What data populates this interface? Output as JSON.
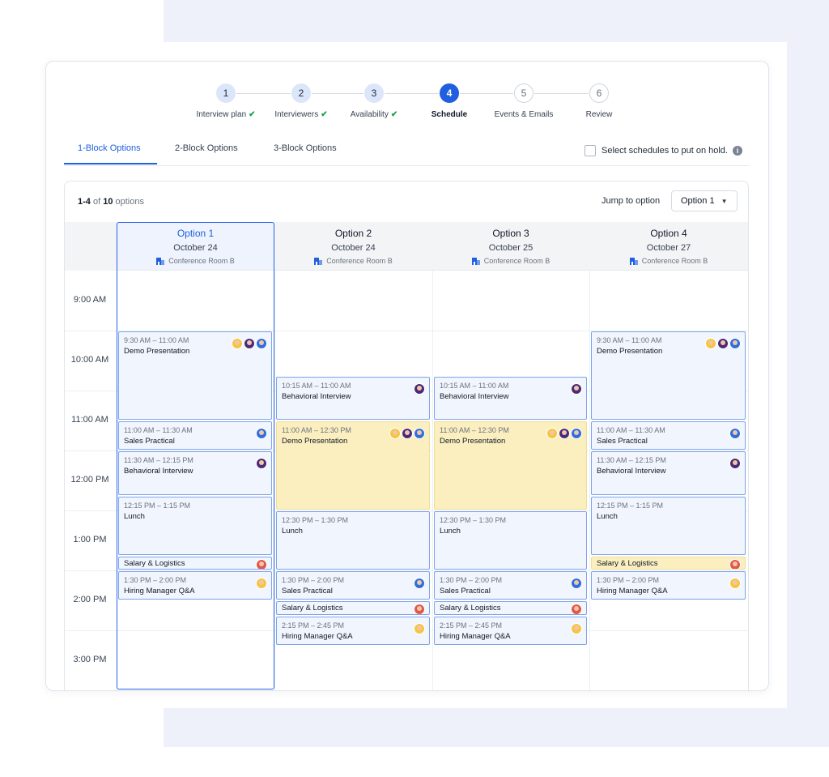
{
  "stepper": [
    {
      "num": "1",
      "label": "Interview plan",
      "state": "done"
    },
    {
      "num": "2",
      "label": "Interviewers",
      "state": "done"
    },
    {
      "num": "3",
      "label": "Availability",
      "state": "done"
    },
    {
      "num": "4",
      "label": "Schedule",
      "state": "active"
    },
    {
      "num": "5",
      "label": "Events & Emails",
      "state": "todo"
    },
    {
      "num": "6",
      "label": "Review",
      "state": "todo"
    }
  ],
  "check_mark": "✔",
  "tabs": [
    "1-Block Options",
    "2-Block Options",
    "3-Block Options"
  ],
  "active_tab": 0,
  "hold_label": "Select schedules to put on hold.",
  "info_glyph": "i",
  "count": {
    "range": "1-4",
    "of": " of ",
    "total": "10",
    "suffix": " options"
  },
  "jump": {
    "label": "Jump to option",
    "value": "Option 1",
    "caret": "▼"
  },
  "hours": [
    "9:00 AM",
    "10:00 AM",
    "11:00 AM",
    "12:00 PM",
    "1:00 PM",
    "2:00 PM",
    "3:00 PM"
  ],
  "colors": {
    "accent": "#1f5fe0",
    "event_bg": "#f1f5fd",
    "event_border": "#7ea3ea",
    "highlight_bg": "#fbefbf"
  },
  "options": [
    {
      "title": "Option 1",
      "date": "October 24",
      "room": "Conference Room B",
      "selected": true,
      "events": [
        {
          "start": "9:30",
          "end": "11:00",
          "time": "9:30 AM – 11:00 AM",
          "title": "Demo Presentation",
          "avatars": [
            "a1",
            "a2",
            "a3"
          ]
        },
        {
          "start": "11:00",
          "end": "11:30",
          "time": "11:00 AM – 11:30 AM",
          "title": "Sales Practical",
          "avatars": [
            "a3"
          ]
        },
        {
          "start": "11:30",
          "end": "12:15",
          "time": "11:30 AM – 12:15 PM",
          "title": "Behavioral Interview",
          "avatars": [
            "a2"
          ]
        },
        {
          "start": "12:15",
          "end": "13:15",
          "time": "12:15 PM – 1:15 PM",
          "title": "Lunch",
          "avatars": []
        },
        {
          "start": "13:15",
          "end": "13:30",
          "time": "",
          "title": "Salary & Logistics",
          "avatars": [
            "a4"
          ]
        },
        {
          "start": "13:30",
          "end": "14:00",
          "time": "1:30 PM – 2:00 PM",
          "title": "Hiring Manager Q&A",
          "avatars": [
            "a1"
          ]
        }
      ]
    },
    {
      "title": "Option 2",
      "date": "October 24",
      "room": "Conference Room B",
      "selected": false,
      "events": [
        {
          "start": "10:15",
          "end": "11:00",
          "time": "10:15 AM – 11:00 AM",
          "title": "Behavioral Interview",
          "avatars": [
            "a2"
          ]
        },
        {
          "start": "11:00",
          "end": "12:30",
          "time": "11:00 AM – 12:30 PM",
          "title": "Demo Presentation",
          "avatars": [
            "a1",
            "a2",
            "a3"
          ],
          "highlight": true
        },
        {
          "start": "12:30",
          "end": "13:30",
          "time": "12:30 PM – 1:30 PM",
          "title": "Lunch",
          "avatars": []
        },
        {
          "start": "13:30",
          "end": "14:00",
          "time": "1:30 PM – 2:00 PM",
          "title": "Sales Practical",
          "avatars": [
            "a3"
          ]
        },
        {
          "start": "14:00",
          "end": "14:15",
          "time": "",
          "title": "Salary & Logistics",
          "avatars": [
            "a4"
          ]
        },
        {
          "start": "14:15",
          "end": "14:45",
          "time": "2:15 PM – 2:45 PM",
          "title": "Hiring Manager Q&A",
          "avatars": [
            "a1"
          ]
        }
      ]
    },
    {
      "title": "Option 3",
      "date": "October 25",
      "room": "Conference Room B",
      "selected": false,
      "events": [
        {
          "start": "10:15",
          "end": "11:00",
          "time": "10:15 AM – 11:00 AM",
          "title": "Behavioral Interview",
          "avatars": [
            "a2"
          ]
        },
        {
          "start": "11:00",
          "end": "12:30",
          "time": "11:00 AM – 12:30 PM",
          "title": "Demo Presentation",
          "avatars": [
            "a1",
            "a2",
            "a3"
          ],
          "highlight": true
        },
        {
          "start": "12:30",
          "end": "13:30",
          "time": "12:30 PM – 1:30 PM",
          "title": "Lunch",
          "avatars": []
        },
        {
          "start": "13:30",
          "end": "14:00",
          "time": "1:30 PM – 2:00 PM",
          "title": "Sales Practical",
          "avatars": [
            "a3"
          ]
        },
        {
          "start": "14:00",
          "end": "14:15",
          "time": "",
          "title": "Salary & Logistics",
          "avatars": [
            "a4"
          ]
        },
        {
          "start": "14:15",
          "end": "14:45",
          "time": "2:15 PM – 2:45 PM",
          "title": "Hiring Manager Q&A",
          "avatars": [
            "a1"
          ]
        }
      ]
    },
    {
      "title": "Option 4",
      "date": "October 27",
      "room": "Conference Room B",
      "selected": false,
      "events": [
        {
          "start": "9:30",
          "end": "11:00",
          "time": "9:30 AM – 11:00 AM",
          "title": "Demo Presentation",
          "avatars": [
            "a1",
            "a2",
            "a3"
          ]
        },
        {
          "start": "11:00",
          "end": "11:30",
          "time": "11:00 AM – 11:30 AM",
          "title": "Sales Practical",
          "avatars": [
            "a3"
          ]
        },
        {
          "start": "11:30",
          "end": "12:15",
          "time": "11:30 AM – 12:15 PM",
          "title": "Behavioral Interview",
          "avatars": [
            "a2"
          ]
        },
        {
          "start": "12:15",
          "end": "13:15",
          "time": "12:15 PM – 1:15 PM",
          "title": "Lunch",
          "avatars": []
        },
        {
          "start": "13:15",
          "end": "13:30",
          "time": "",
          "title": "Salary & Logistics",
          "avatars": [
            "a4"
          ],
          "highlight": true
        },
        {
          "start": "13:30",
          "end": "14:00",
          "time": "1:30 PM – 2:00 PM",
          "title": "Hiring Manager Q&A",
          "avatars": [
            "a1"
          ]
        }
      ]
    }
  ]
}
